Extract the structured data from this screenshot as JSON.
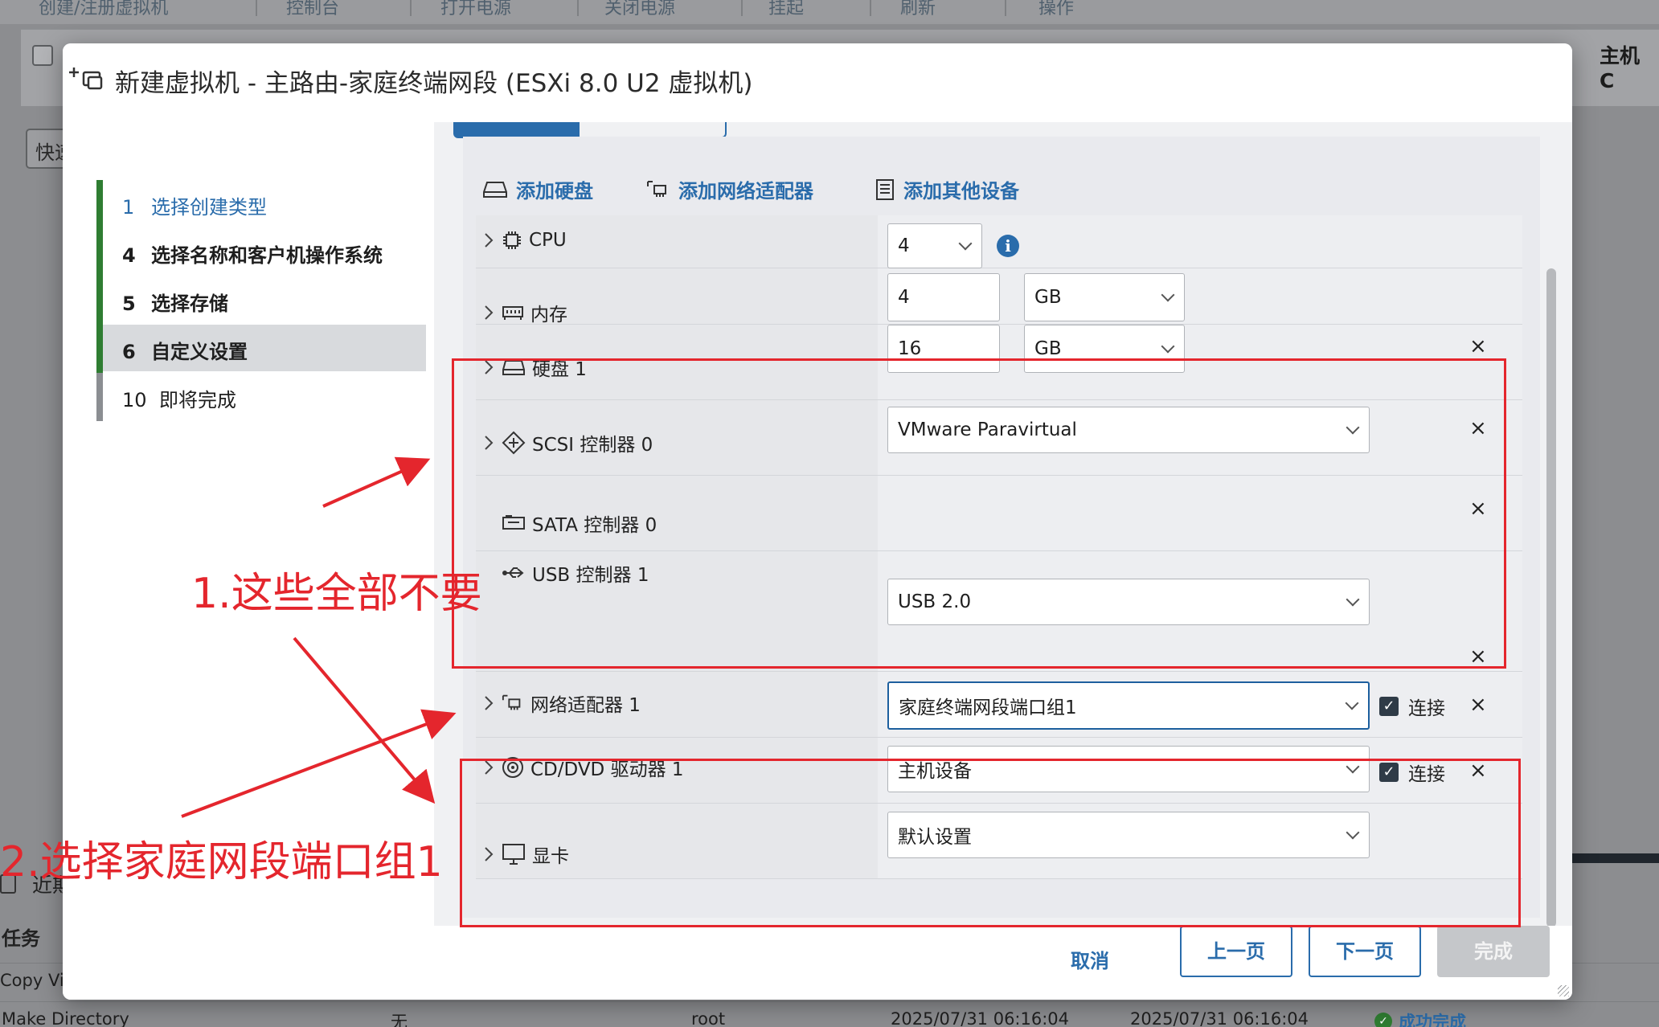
{
  "background": {
    "toolbar": [
      "创建/注册虚拟机",
      "控制台",
      "打开电源",
      "关闭电源",
      "挂起",
      "刷新",
      "操作"
    ],
    "host_column": "主机 C",
    "quick_filter": "快速",
    "recent_tasks": "近期",
    "tasks_header": "任务",
    "rows": [
      {
        "task": "Copy Vi",
        "target": "",
        "initiator": "",
        "queued": "",
        "started": "",
        "result": ""
      },
      {
        "task": "Make Directory",
        "target": "无",
        "initiator": "root",
        "queued": "2025/07/31 06:16:04",
        "started": "2025/07/31 06:16:04",
        "result": "成功完成"
      }
    ]
  },
  "dialog": {
    "title": "新建虚拟机 - 主路由-家庭终端网段 (ESXi 8.0 U2 虚拟机)",
    "steps": [
      {
        "num": "1",
        "label": "选择创建类型"
      },
      {
        "num": "4",
        "label": "选择名称和客户机操作系统"
      },
      {
        "num": "5",
        "label": "选择存储"
      },
      {
        "num": "6",
        "label": "自定义设置"
      },
      {
        "num": "10",
        "label": "即将完成"
      }
    ],
    "add_links": {
      "disk": "添加硬盘",
      "nic": "添加网络适配器",
      "other": "添加其他设备"
    },
    "hardware": {
      "cpu": {
        "label": "CPU",
        "value": "4"
      },
      "memory": {
        "label": "内存",
        "value": "4",
        "unit": "GB"
      },
      "disk1": {
        "label": "硬盘 1",
        "value": "16",
        "unit": "GB"
      },
      "scsi": {
        "label": "SCSI 控制器 0",
        "value": "VMware Paravirtual"
      },
      "sata": {
        "label": "SATA 控制器 0"
      },
      "usb": {
        "label": "USB 控制器 1",
        "value": "USB 2.0"
      },
      "nic1": {
        "label": "网络适配器 1",
        "value": "家庭终端网段端口组1",
        "connect": "连接"
      },
      "cdrom": {
        "label": "CD/DVD 驱动器 1",
        "value": "主机设备",
        "connect": "连接"
      },
      "video": {
        "label": "显卡",
        "value": "默认设置"
      }
    },
    "remove_symbol": "×",
    "buttons": {
      "cancel": "取消",
      "back": "上一页",
      "next": "下一页",
      "finish": "完成"
    }
  },
  "annotations": {
    "note1": "1.这些全部不要",
    "note2": "2.选择家庭网段端口组1"
  },
  "colors": {
    "accent": "#2a6cab",
    "annotation": "#e4262d",
    "success": "#2f7d32"
  }
}
